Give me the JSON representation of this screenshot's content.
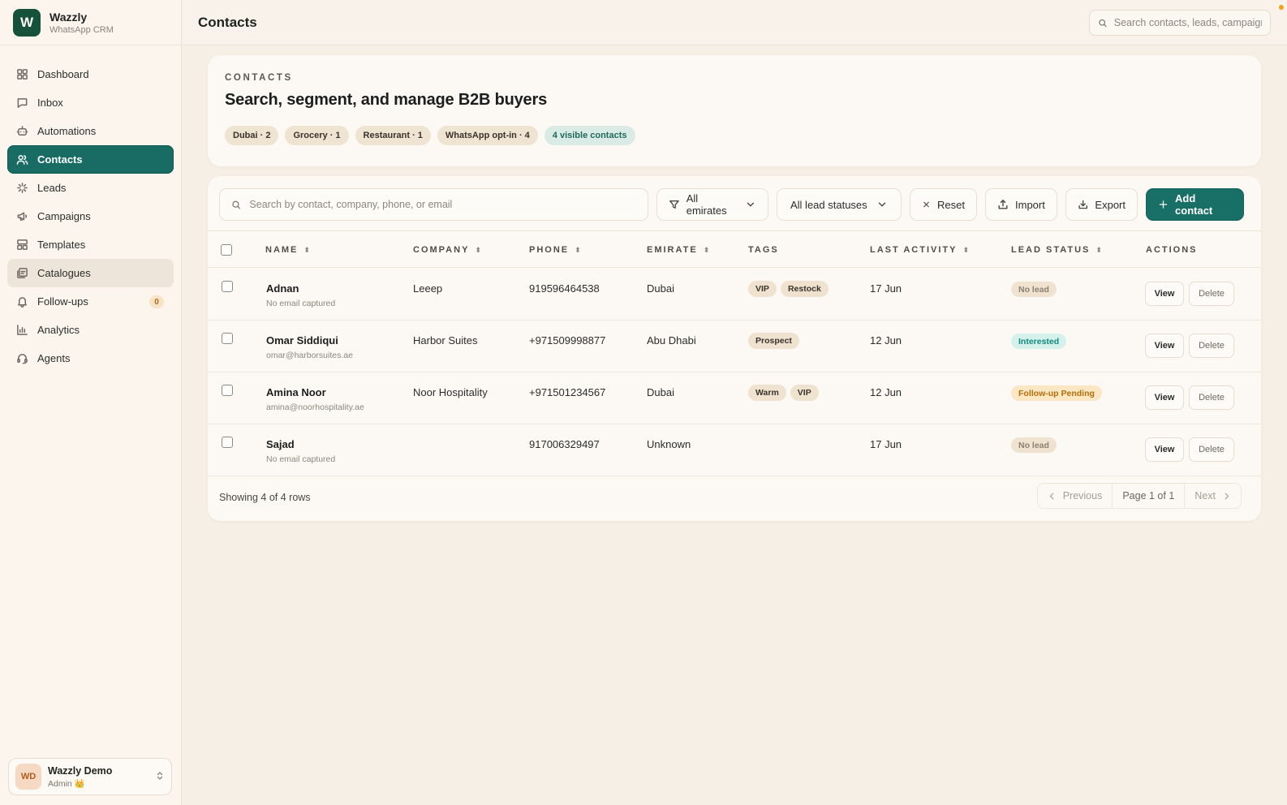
{
  "app": {
    "logo_letter": "W",
    "name": "Wazzly",
    "subtitle": "WhatsApp CRM",
    "accent_color": "#186c64"
  },
  "sidebar": {
    "items": [
      {
        "label": "Dashboard",
        "icon": "dashboard-icon"
      },
      {
        "label": "Inbox",
        "icon": "inbox-icon"
      },
      {
        "label": "Automations",
        "icon": "robot-icon"
      },
      {
        "label": "Contacts",
        "icon": "users-icon",
        "active": true
      },
      {
        "label": "Leads",
        "icon": "sparkle-icon"
      },
      {
        "label": "Campaigns",
        "icon": "megaphone-icon"
      },
      {
        "label": "Templates",
        "icon": "template-icon"
      },
      {
        "label": "Catalogues",
        "icon": "catalogue-icon"
      },
      {
        "label": "Follow-ups",
        "icon": "bell-icon",
        "badge": "0"
      },
      {
        "label": "Analytics",
        "icon": "chart-icon"
      },
      {
        "label": "Agents",
        "icon": "headset-icon"
      }
    ],
    "user": {
      "initials": "WD",
      "name": "Wazzly Demo",
      "role": "Admin 👑"
    }
  },
  "topbar": {
    "title": "Contacts",
    "search_placeholder": "Search contacts, leads, campaigns"
  },
  "hero": {
    "eyebrow": "CONTACTS",
    "title": "Search, segment, and manage B2B buyers",
    "chips": [
      "Dubai · 2",
      "Grocery · 1",
      "Restaurant · 1",
      "WhatsApp opt-in · 4",
      "4 visible contacts"
    ]
  },
  "toolbar": {
    "search_placeholder": "Search by contact, company, phone, or email",
    "emirate_filter": "All emirates",
    "status_filter": "All lead statuses",
    "reset_label": "Reset",
    "import_label": "Import",
    "export_label": "Export",
    "add_label": "Add contact"
  },
  "table": {
    "headers": {
      "name": "NAME",
      "company": "COMPANY",
      "phone": "PHONE",
      "emirate": "EMIRATE",
      "tags": "TAGS",
      "last_activity": "LAST ACTIVITY",
      "lead_status": "LEAD STATUS",
      "actions": "ACTIONS"
    },
    "rows": [
      {
        "name": "Adnan",
        "email": "No email captured",
        "company": "Leeep",
        "phone": "919596464538",
        "emirate": "Dubai",
        "tags": [
          "VIP",
          "Restock"
        ],
        "last_activity": "17 Jun",
        "status": "No lead",
        "status_kind": "nolead"
      },
      {
        "name": "Omar Siddiqui",
        "email": "omar@harborsuites.ae",
        "company": "Harbor Suites",
        "phone": "+971509998877",
        "emirate": "Abu Dhabi",
        "tags": [
          "Prospect"
        ],
        "last_activity": "12 Jun",
        "status": "Interested",
        "status_kind": "interested"
      },
      {
        "name": "Amina Noor",
        "email": "amina@noorhospitality.ae",
        "company": "Noor Hospitality",
        "phone": "+971501234567",
        "emirate": "Dubai",
        "tags": [
          "Warm",
          "VIP"
        ],
        "last_activity": "12 Jun",
        "status": "Follow-up Pending",
        "status_kind": "pending"
      },
      {
        "name": "Sajad",
        "email": "No email captured",
        "company": "",
        "phone": "917006329497",
        "emirate": "Unknown",
        "tags": [],
        "last_activity": "17 Jun",
        "status": "No lead",
        "status_kind": "nolead"
      }
    ],
    "view_label": "View",
    "delete_label": "Delete"
  },
  "footer": {
    "showing": "Showing 4 of 4 rows",
    "previous": "Previous",
    "page": "Page 1 of 1",
    "next": "Next"
  }
}
